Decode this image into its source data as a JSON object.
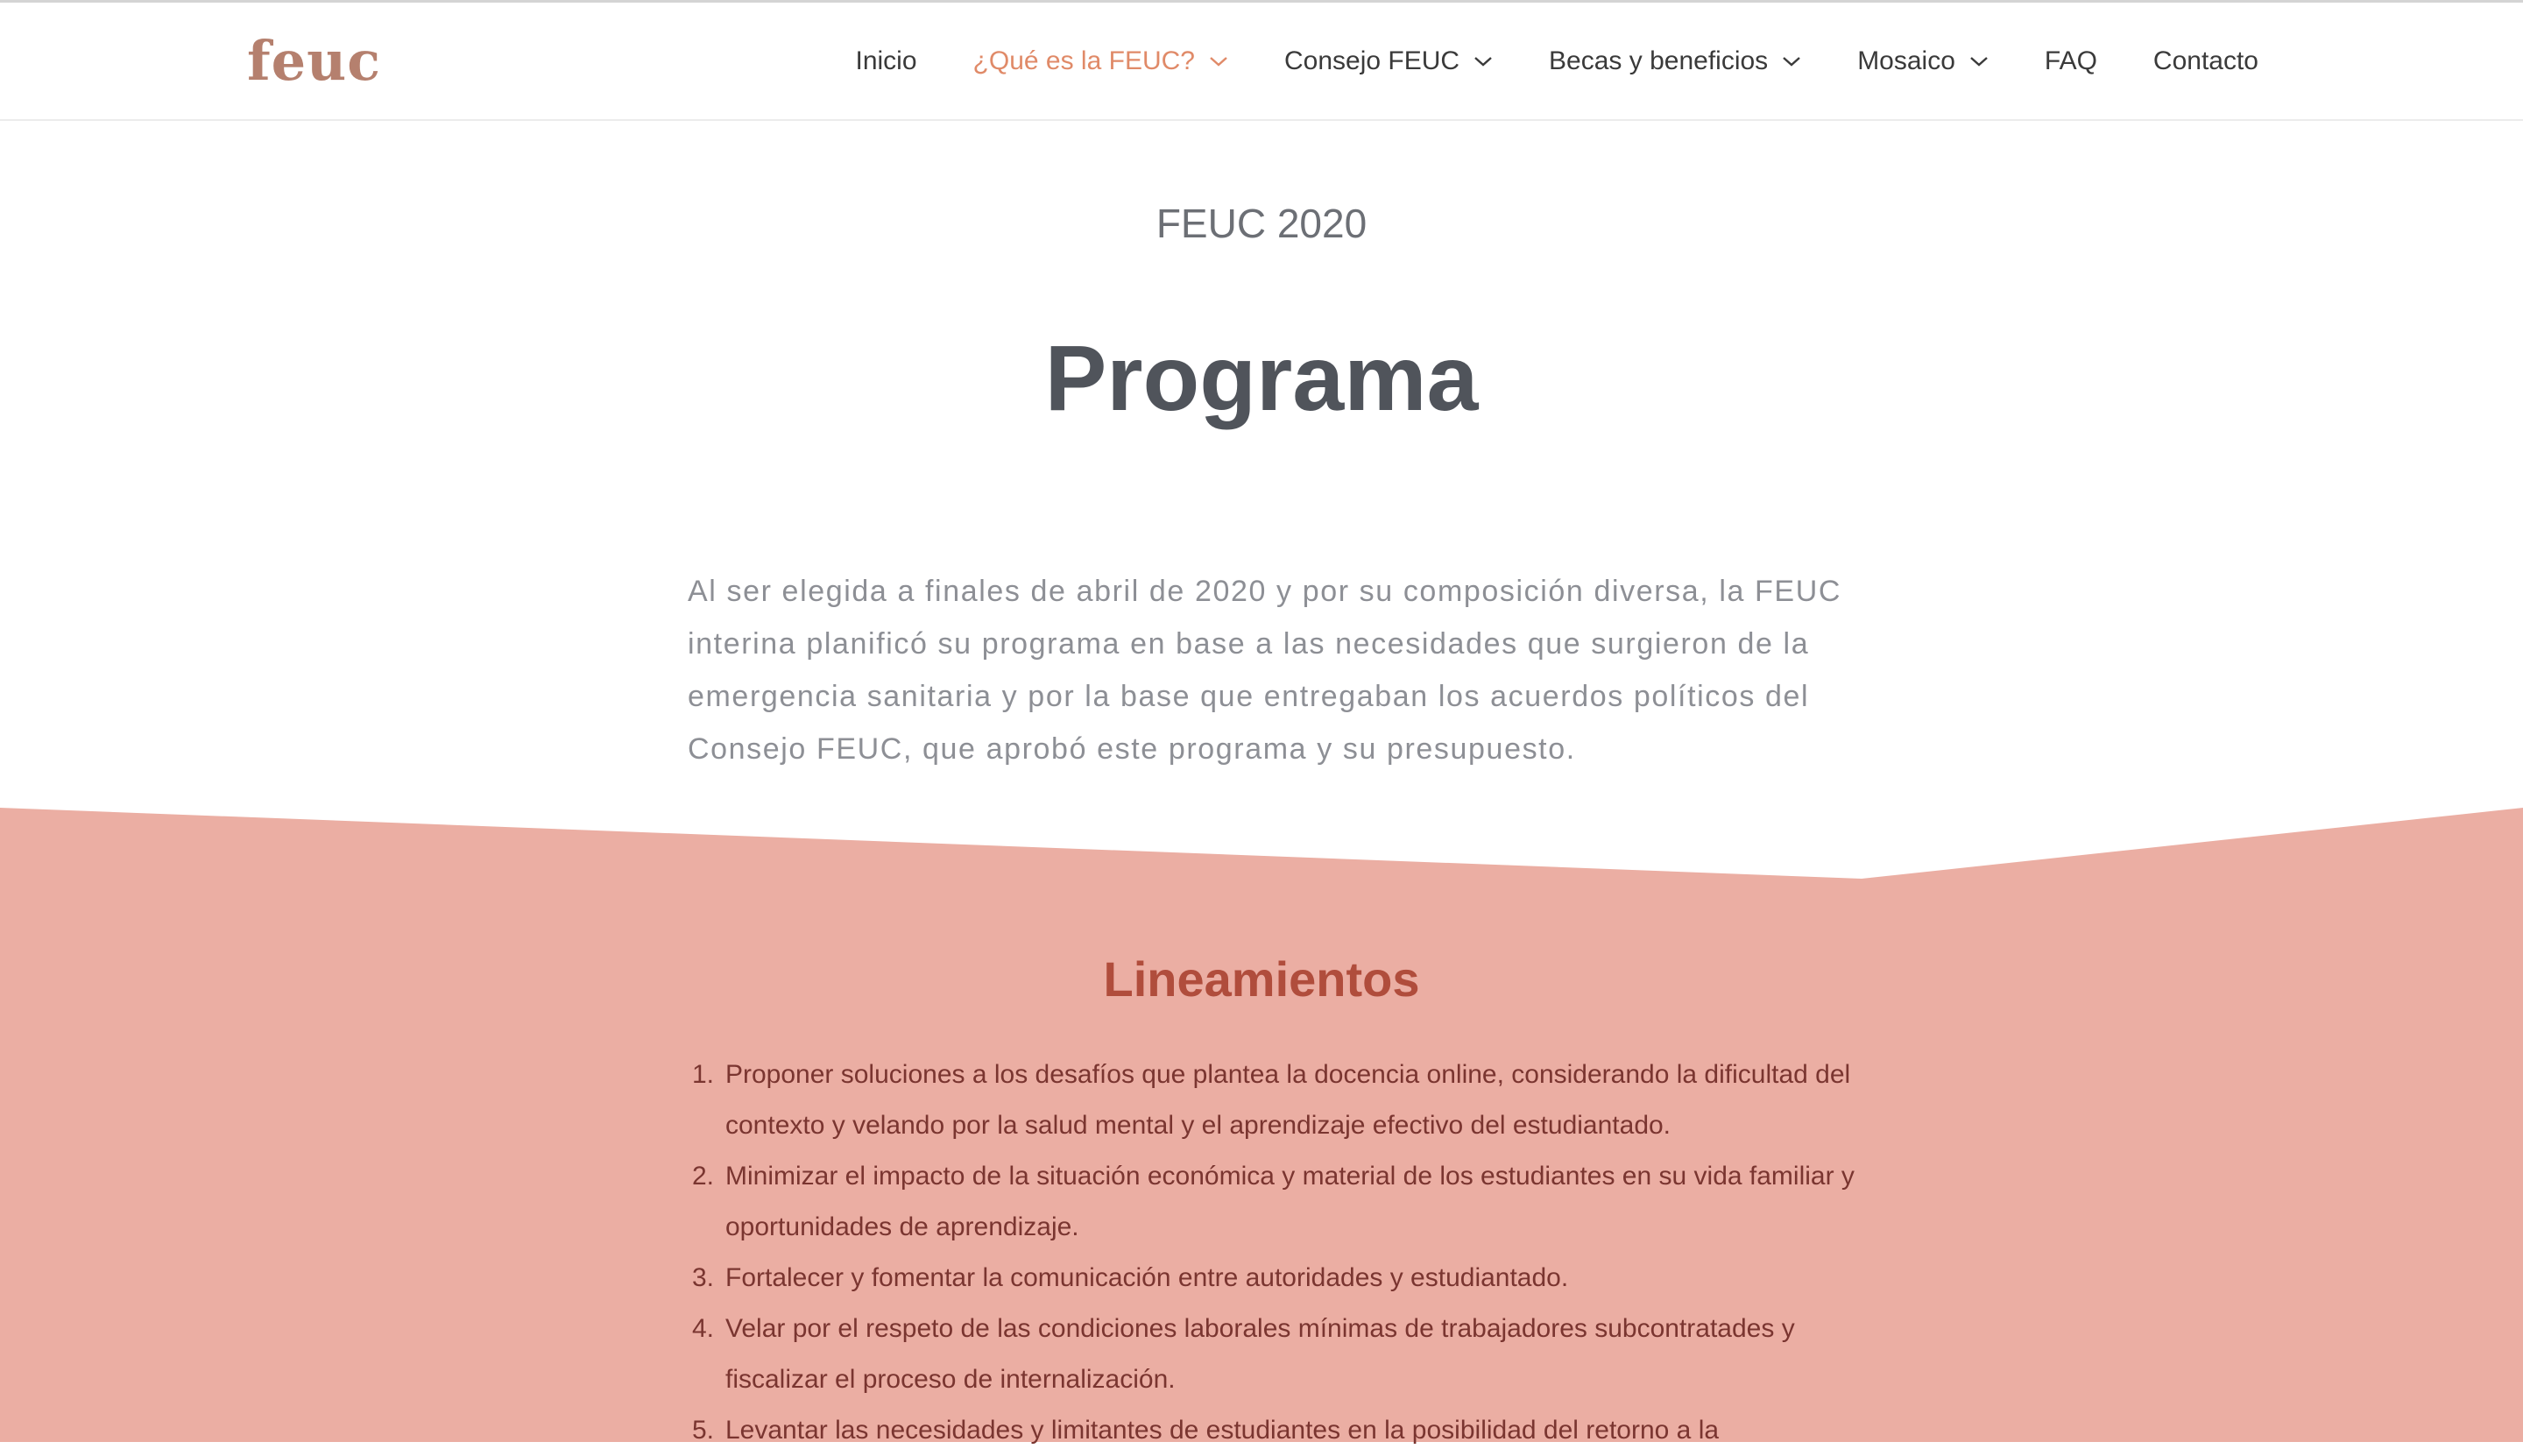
{
  "header": {
    "logo": "feuc",
    "nav": [
      {
        "label": "Inicio",
        "dropdown": false,
        "active": false
      },
      {
        "label": "¿Qué es la FEUC?",
        "dropdown": true,
        "active": true
      },
      {
        "label": "Consejo FEUC",
        "dropdown": true,
        "active": false
      },
      {
        "label": "Becas y beneficios",
        "dropdown": true,
        "active": false
      },
      {
        "label": "Mosaico",
        "dropdown": true,
        "active": false
      },
      {
        "label": "FAQ",
        "dropdown": false,
        "active": false
      },
      {
        "label": "Contacto",
        "dropdown": false,
        "active": false
      }
    ]
  },
  "hero": {
    "eyebrow": "FEUC 2020",
    "title": "Programa",
    "intro": "Al ser elegida a finales de abril de 2020 y por su composición diversa, la FEUC interina planificó su programa en base a las necesidades que surgieron de la emergencia sanitaria y por la base que entregaban los acuerdos políticos del Consejo FEUC, que aprobó este programa y su presupuesto."
  },
  "lineamientos": {
    "title": "Lineamientos",
    "items": [
      {
        "num": "1.",
        "text": "Proponer soluciones a los desafíos que plantea la docencia online, considerando la dificultad del contexto y velando por la salud mental y el aprendizaje efectivo del estudiantado."
      },
      {
        "num": "2.",
        "text": "Minimizar el impacto de la situación económica y material de los estudiantes en su vida familiar y oportunidades de aprendizaje."
      },
      {
        "num": "3.",
        "text": "Fortalecer y fomentar la comunicación entre autoridades y estudiantado."
      },
      {
        "num": "4.",
        "text": "Velar por el respeto de las condiciones laborales mínimas de trabajadores subcontratades y fiscalizar el proceso de internalización."
      },
      {
        "num": "5.",
        "text": "Levantar las necesidades y limitantes de estudiantes en la posibilidad del retorno a la"
      }
    ]
  },
  "colors": {
    "accent": "#e08a68",
    "logo": "#b5806e",
    "band": "#ebaea3",
    "section_title": "#b04d3c",
    "list_text": "#7a3530"
  }
}
